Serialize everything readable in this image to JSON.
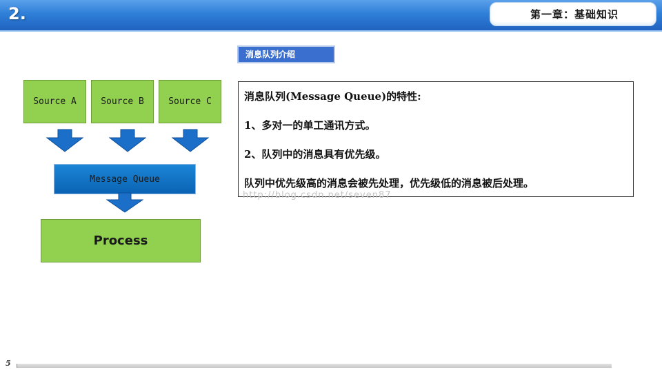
{
  "header": {
    "slide_number": "2.",
    "chapter_title": "第一章：基础知识"
  },
  "section_tab": {
    "label": "消息队列介绍"
  },
  "diagram": {
    "sources": [
      "Source A",
      "Source B",
      "Source C"
    ],
    "queue": "Message Queue",
    "process": "Process"
  },
  "text_panel": {
    "lines": [
      "消息队列(Message Queue)的特性:",
      "1、多对一的单工通讯方式。",
      "2、队列中的消息具有优先级。",
      "队列中优先级高的消息会被先处理，优先级低的消息被后处理。"
    ]
  },
  "watermark": "http://blog.csdn.net/seven87",
  "footer": {
    "page_number": "5"
  },
  "colors": {
    "header_blue": "#2f7fd8",
    "box_green": "#92d050",
    "queue_blue": "#0b63b4",
    "arrow_blue": "#1b6fc9",
    "tab_blue": "#3a6fcf"
  }
}
